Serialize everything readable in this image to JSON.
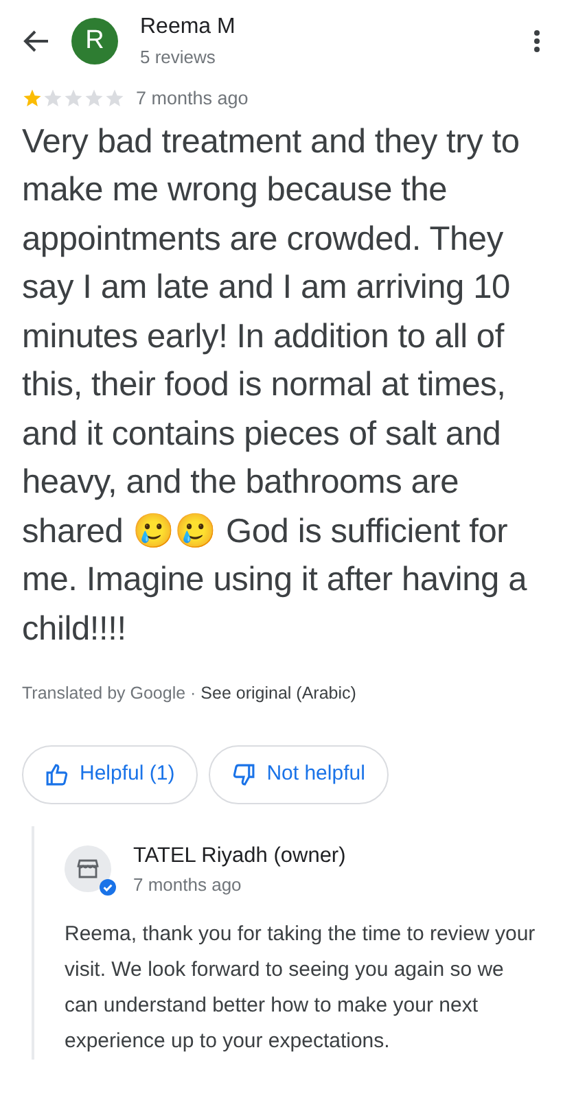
{
  "header": {
    "avatar_letter": "R",
    "name": "Reema M",
    "subtitle": "5 reviews"
  },
  "review": {
    "stars": 1,
    "time": "7 months ago",
    "text": "Very bad treatment and they try to make me wrong because the appointments are crowded. They say I am late and I am arriving 10 minutes early! In addition to all of this, their food is normal at times, and it contains pieces of salt and heavy, and the bathrooms are shared 🥲🥲 God is sufficient for me. Imagine using it after having a child!!!!",
    "translated": "Translated by Google ·",
    "see_original": "See original (Arabic)"
  },
  "actions": [
    {
      "kind": "helpful",
      "label": "Helpful (1)"
    },
    {
      "kind": "not_helpful",
      "label": "Not helpful"
    }
  ],
  "owner_reply": {
    "name": "TATEL Riyadh (owner)",
    "verified": true,
    "time": "7 months ago",
    "text": "Reema, thank you for taking the time to review your visit. We look forward to seeing you again so we can understand better how to make your next experience up to your expectations."
  }
}
